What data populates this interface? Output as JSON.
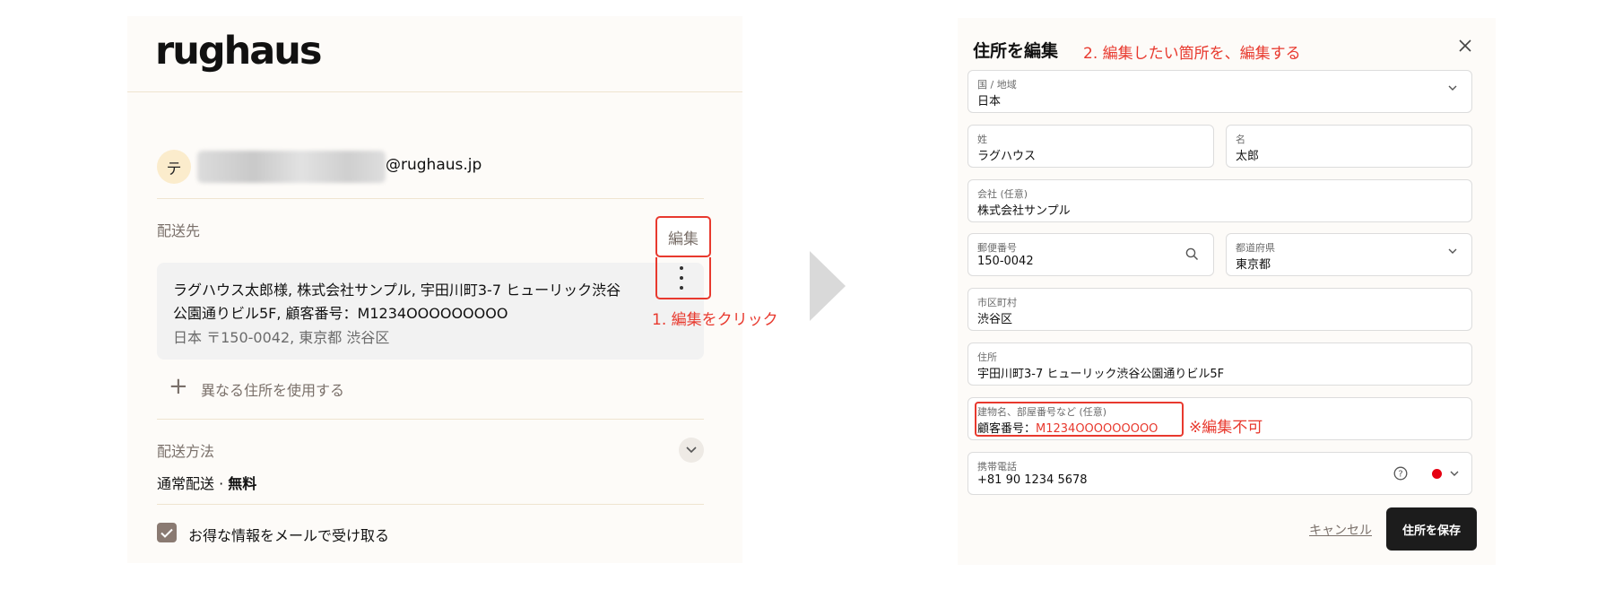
{
  "left": {
    "logo": "rughaus",
    "avatar_initial": "テ",
    "email_domain": "@rughaus.jp",
    "shipping_title": "配送先",
    "address_line1": "ラグハウス太郎様, 株式会社サンプル, 宇田川町3-7 ヒューリック渋谷",
    "address_line2": "公園通りビル5F, 顧客番号：M1234OOOOOOOOO",
    "address_sub": "日本 〒150-0042, 東京都 渋谷区",
    "edit_popup": "編集",
    "step1_note": "1. 編集をクリック",
    "alt_address": "異なる住所を使用する",
    "shipping_method_title": "配送方法",
    "shipping_method": "通常配送 · ",
    "shipping_free": "無料",
    "newsletter": "お得な情報をメールで受け取る"
  },
  "modal": {
    "title": "住所を編集",
    "step2_note": "2. 編集したい箇所を、編集する",
    "fields": {
      "country": {
        "label": "国 / 地域",
        "value": "日本"
      },
      "last_name": {
        "label": "姓",
        "value": "ラグハウス"
      },
      "first_name": {
        "label": "名",
        "value": "太郎"
      },
      "company": {
        "label": "会社 (任意)",
        "value": "株式会社サンプル"
      },
      "postal": {
        "label": "郵便番号",
        "value": "150-0042"
      },
      "prefecture": {
        "label": "都道府県",
        "value": "東京都"
      },
      "city": {
        "label": "市区町村",
        "value": "渋谷区"
      },
      "address": {
        "label": "住所",
        "value": "宇田川町3-7 ヒューリック渋谷公園通りビル5F"
      },
      "building": {
        "label": "建物名、部屋番号など (任意)",
        "value_prefix": "顧客番号：",
        "value_highlight": "M1234OOOOOOOOO"
      },
      "phone": {
        "label": "携帯電話",
        "value": "+81 90 1234 5678"
      }
    },
    "not_editable_note": "※編集不可",
    "cancel": "キャンセル",
    "save": "住所を保存"
  },
  "colors": {
    "accent_red": "#e8392e",
    "panel_bg": "#fdfbf8",
    "button_dark": "#1c1c1c"
  }
}
